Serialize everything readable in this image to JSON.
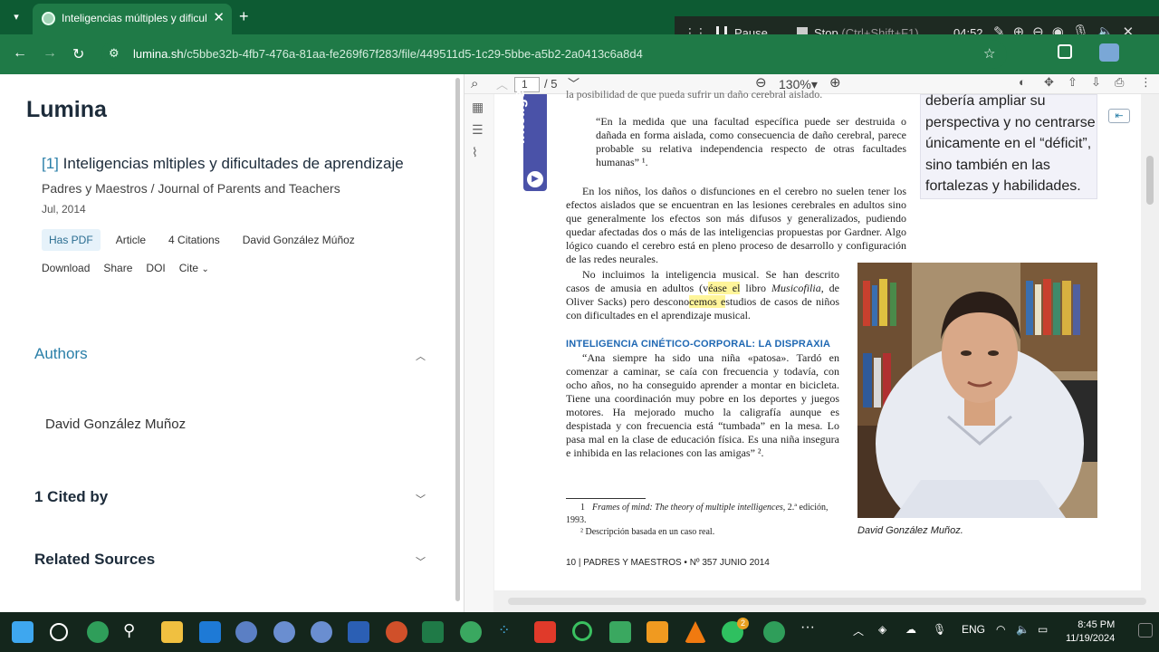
{
  "browser": {
    "tab_title": "Inteligencias múltiples y dificult",
    "url_host": "lumina.sh",
    "url_path": "/c5bbe32b-4fb7-476a-81aa-fe269f67f283/file/449511d5-1c29-5bbe-a5b2-2a0413c6a8d4"
  },
  "recorder": {
    "pause_label": "Pause",
    "stop_label": "Stop",
    "stop_shortcut": "(Ctrl+Shift+F1)",
    "time": "04:52"
  },
  "sidebar": {
    "brand": "Lumina",
    "paper_ref": "[1]",
    "paper_title": "Inteligencias mltiples y dificultades de aprendizaje",
    "journal": "Padres y Maestros / Journal of Parents and Teachers",
    "date": "Jul, 2014",
    "badges": [
      "Has PDF",
      "Article",
      "4 Citations",
      "David González Múñoz"
    ],
    "actions": [
      "Download",
      "Share",
      "DOI",
      "Cite"
    ],
    "authors_heading": "Authors",
    "author_name": "David González Muñoz",
    "cited_heading": "1 Cited by",
    "related_heading": "Related Sources"
  },
  "pdf": {
    "page_current": "1",
    "page_total": "/ 5",
    "zoom": "130%",
    "side_vertical_text": "Intelige",
    "line0": "la posibilidad de que pueda sufrir un daño cerebral aislado.",
    "quote1": "“En la medida que una facultad específica puede ser destruida o dañada en forma aislada, como consecuencia de daño cerebral, parece probable su relativa independencia respecto de otras facultades humanas” ¹.",
    "para1": "En los niños, los daños o disfunciones en el cerebro no suelen tener los efectos aislados que se encuentran en las lesiones cerebrales en adultos sino que generalmente los efectos son más difusos y generalizados, pudiendo quedar afectadas dos o más de las inteligencias propuestas por Gardner. Algo lógico cuando el cerebro está en pleno proceso de desarrollo y configuración de las redes neurales.",
    "para2_a": "No incluimos la inteligencia musical. Se han descrito casos de amusia en adultos (v",
    "para2_hl": "éase el",
    "para2_b": " libro ",
    "para2_book": "Musicofilia",
    "para2_c": ", de Oliver Sacks) pero descono",
    "para2_hl2": "cemos e",
    "para2_d": "studios de casos de niños con dificultades en el aprendizaje musical.",
    "section_title": "Inteligencia cinético-corporal: la dispraxia",
    "para3": "“Ana siempre ha sido una niña «patosa». Tardó en comenzar a caminar, se caía con frecuencia y todavía, con ocho años, no ha conseguido aprender a montar en bicicleta. Tiene una coordinación muy pobre en los deportes y juegos motores. Ha mejorado mucho la caligrafía aunque es despistada y con frecuencia está “tumbada” en la mesa. Lo pasa mal en la clase de educación física. Es una niña insegura e inhibida en las relaciones con las amigas” ².",
    "fn1_num": "1",
    "fn1_title": "Frames of mind: The theory of multiple intelligences",
    "fn1_rest": ", 2.ª edición, 1993.",
    "fn2": "²  Descripción basada en un caso real.",
    "footer": "10  |  PADRES Y MAESTROS • Nº 357 JUNIO 2014",
    "highlight_box": "debería ampliar su perspectiva y no centrarse únicamente en el “déficit”, sino también en las fortalezas y habilidades.",
    "caption": "David González Muñoz."
  },
  "taskbar": {
    "lang": "ENG",
    "time": "8:45 PM",
    "date": "11/19/2024",
    "whatsapp_badge": "2"
  },
  "colors": {
    "chrome_dark": "#0d5b33",
    "chrome": "#1f7a47",
    "link": "#2a7fa8",
    "section_blue": "#1f68b3",
    "highlight": "#fff59a"
  }
}
